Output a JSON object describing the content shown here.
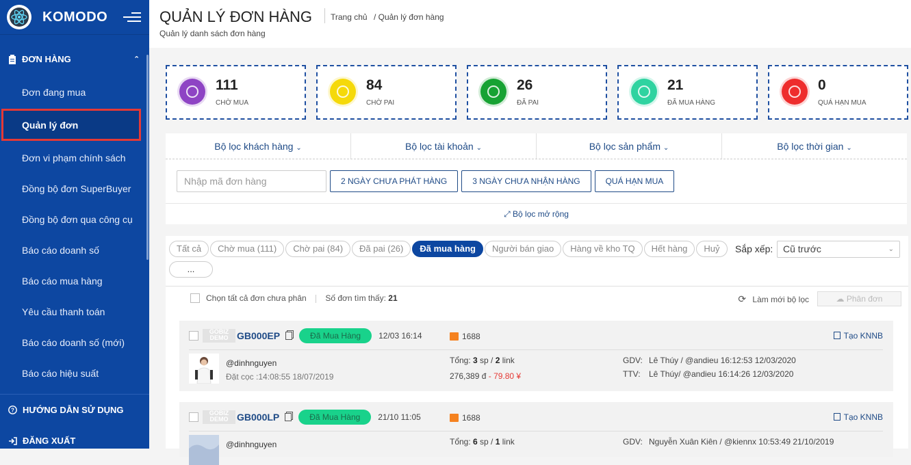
{
  "sidebar": {
    "brand": "KOMODO",
    "group_title": "ĐƠN HÀNG",
    "items": [
      {
        "label": "Đơn đang mua",
        "active": false
      },
      {
        "label": "Quản lý đơn",
        "active": true
      },
      {
        "label": "Đơn vi phạm chính sách",
        "active": false
      },
      {
        "label": "Đồng bộ đơn SuperBuyer",
        "active": false
      },
      {
        "label": "Đồng bộ đơn qua công cụ",
        "active": false
      },
      {
        "label": "Báo cáo doanh số",
        "active": false
      },
      {
        "label": "Báo cáo mua hàng",
        "active": false
      },
      {
        "label": "Yêu cầu thanh toán",
        "active": false
      },
      {
        "label": "Báo cáo doanh số (mới)",
        "active": false
      },
      {
        "label": "Báo cáo hiệu suất",
        "active": false
      }
    ],
    "guide": "HƯỚNG DẪN SỬ DỤNG",
    "logout": "ĐĂNG XUẤT"
  },
  "header": {
    "title": "QUẢN LÝ ĐƠN HÀNG",
    "subtitle": "Quản lý danh sách đơn hàng",
    "breadcrumb_home": "Trang chủ",
    "breadcrumb_current": "/ Quản lý đơn hàng"
  },
  "stats": [
    {
      "value": "111",
      "label": "Chờ mua",
      "color": "#8e44c4",
      "icon": "cart-icon"
    },
    {
      "value": "84",
      "label": "Chờ pai",
      "color": "#f5d90a",
      "icon": "bag-icon"
    },
    {
      "value": "26",
      "label": "Đã pai",
      "color": "#17a233",
      "icon": "check-icon"
    },
    {
      "value": "21",
      "label": "Đã mua hàng",
      "color": "#2fd3a0",
      "icon": "shopping-bag-icon"
    },
    {
      "value": "0",
      "label": "Quá hạn mua",
      "color": "#ee2d2d",
      "icon": "alarm-icon"
    }
  ],
  "filters": {
    "tabs": [
      "Bộ lọc khách hàng",
      "Bộ lọc tài khoản",
      "Bộ lọc sản phẩm",
      "Bộ lọc thời gian"
    ],
    "search_placeholder": "Nhập mã đơn hàng",
    "quick_buttons": [
      "2 NGÀY CHƯA PHÁT HÀNG",
      "3 NGÀY CHƯA NHẬN HÀNG",
      "QUÁ HẠN MUA"
    ],
    "expand_label": "Bộ lọc mở rộng"
  },
  "status_chips": [
    "Tất cả",
    "Chờ mua (111)",
    "Chờ pai (84)",
    "Đã pai (26)",
    "Đã mua hàng",
    "Người bán giao",
    "Hàng về kho TQ",
    "Hết hàng",
    "Huỷ",
    "..."
  ],
  "active_chip": "Đã mua hàng",
  "sort": {
    "label": "Sắp xếp:",
    "value": "Cũ trước"
  },
  "toolbar": {
    "select_all": "Chọn tất cả đơn chưa phân",
    "found_label": "Số đơn tìm thấy:",
    "found_count": "21",
    "refresh": "Làm mới bộ lọc",
    "assign": "Phân đơn"
  },
  "orders": [
    {
      "watermark": "GOBIZ DEMO",
      "code": "GB000EP",
      "status": "Đã Mua Hàng",
      "date": "12/03 16:14",
      "source": "1688",
      "action": "Tạo KNNB",
      "user": "@dinhnguyen",
      "deposit": "Đặt cọc :14:08:55 18/07/2019",
      "total_prefix": "Tổng:",
      "total_sp": "3",
      "total_link": "2",
      "amount": "276,389 đ",
      "amount_cny": "- 79.80 ¥",
      "gdv_label": "GDV:",
      "gdv": "Lê Thúy / @andieu 16:12:53 12/03/2020",
      "ttv_label": "TTV:",
      "ttv": "Lê Thúy/ @andieu 16:14:26 12/03/2020"
    },
    {
      "watermark": "GOBIZ DEMO",
      "code": "GB000LP",
      "status": "Đã Mua Hàng",
      "date": "21/10 11:05",
      "source": "1688",
      "action": "Tạo KNNB",
      "user": "@dinhnguyen",
      "total_prefix": "Tổng:",
      "total_sp": "6",
      "total_link": "1",
      "gdv_label": "GDV:",
      "gdv": "Nguyễn Xuân Kiên / @kiennx 10:53:49 21/10/2019"
    }
  ]
}
